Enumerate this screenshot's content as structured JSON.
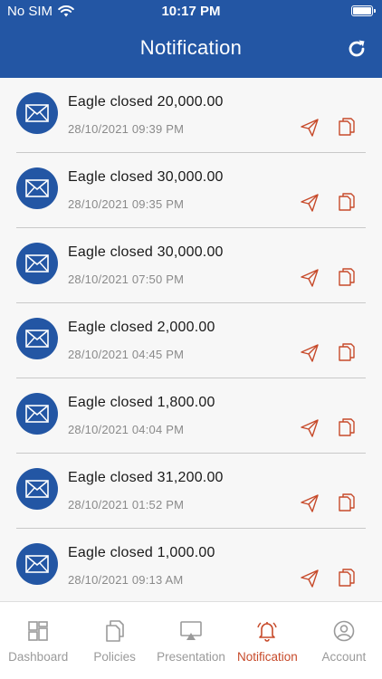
{
  "status_bar": {
    "carrier": "No SIM",
    "time": "10:17 PM"
  },
  "header": {
    "title": "Notification"
  },
  "notifications": [
    {
      "title": "Eagle closed 20,000.00",
      "time": "28/10/2021 09:39 PM"
    },
    {
      "title": "Eagle closed 30,000.00",
      "time": "28/10/2021 09:35 PM"
    },
    {
      "title": "Eagle closed 30,000.00",
      "time": "28/10/2021 07:50 PM"
    },
    {
      "title": "Eagle closed 2,000.00",
      "time": "28/10/2021 04:45 PM"
    },
    {
      "title": "Eagle closed 1,800.00",
      "time": "28/10/2021 04:04 PM"
    },
    {
      "title": "Eagle closed 31,200.00",
      "time": "28/10/2021 01:52 PM"
    },
    {
      "title": "Eagle closed 1,000.00",
      "time": "28/10/2021 09:13 AM"
    }
  ],
  "tabs": [
    {
      "label": "Dashboard",
      "icon": "dashboard-icon",
      "active": false
    },
    {
      "label": "Policies",
      "icon": "policies-icon",
      "active": false
    },
    {
      "label": "Presentation",
      "icon": "presentation-icon",
      "active": false
    },
    {
      "label": "Notification",
      "icon": "bell-icon",
      "active": true
    },
    {
      "label": "Account",
      "icon": "account-icon",
      "active": false
    }
  ],
  "colors": {
    "primary": "#2356a4",
    "accent": "#c74a2a",
    "inactive": "#9a9a9a"
  }
}
